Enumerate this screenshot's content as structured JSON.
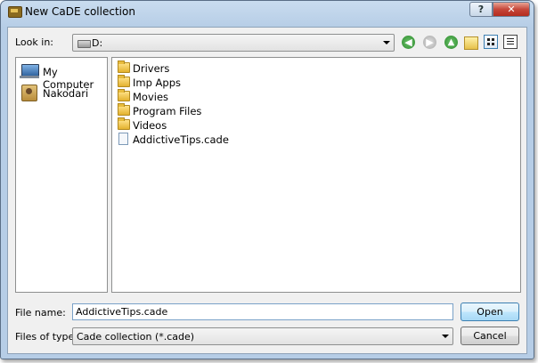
{
  "window": {
    "title": "New CaDE collection"
  },
  "caption": {
    "help": "?",
    "close": "✕"
  },
  "lookin": {
    "label": "Look in:",
    "value": "D:"
  },
  "toolbar": {
    "back": "◀",
    "forward": "▶",
    "up": "▲"
  },
  "places": [
    {
      "label": "My Computer",
      "icon": "computer-icon"
    },
    {
      "label": "Nakodari",
      "icon": "user-icon"
    }
  ],
  "files": [
    {
      "name": "Drivers",
      "type": "folder"
    },
    {
      "name": "Imp Apps",
      "type": "folder"
    },
    {
      "name": "Movies",
      "type": "folder"
    },
    {
      "name": "Program Files",
      "type": "folder"
    },
    {
      "name": "Videos",
      "type": "folder"
    },
    {
      "name": "AddictiveTips.cade",
      "type": "file"
    }
  ],
  "filename": {
    "label": "File name:",
    "value": "AddictiveTips.cade"
  },
  "filetype": {
    "label": "Files of type:",
    "value": "Cade collection (*.cade)"
  },
  "buttons": {
    "open": "Open",
    "cancel": "Cancel"
  }
}
